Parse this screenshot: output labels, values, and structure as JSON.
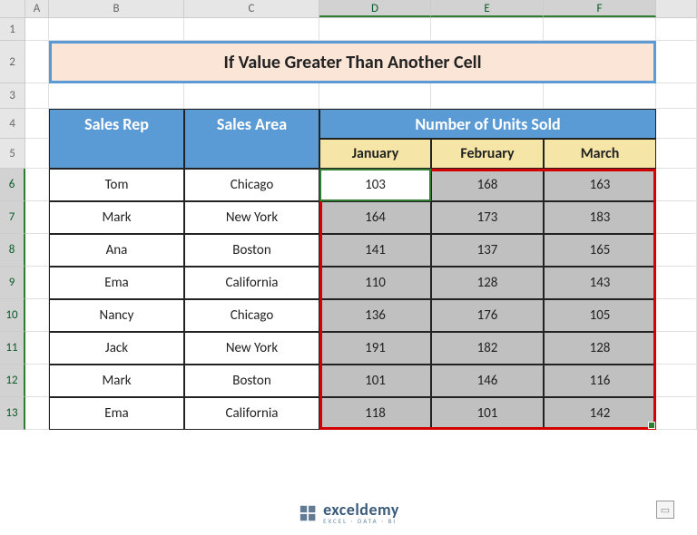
{
  "columns": [
    "A",
    "B",
    "C",
    "D",
    "E",
    "F"
  ],
  "selected_cols": [
    "D",
    "E",
    "F"
  ],
  "rows": [
    1,
    2,
    3,
    4,
    5,
    6,
    7,
    8,
    9,
    10,
    11,
    12,
    13
  ],
  "selected_rows": [
    6,
    7,
    8,
    9,
    10,
    11,
    12,
    13
  ],
  "title": "If Value Greater Than Another Cell",
  "headers": {
    "rep": "Sales Rep",
    "area": "Sales Area",
    "units": "Number of Units Sold",
    "months": [
      "January",
      "February",
      "March"
    ]
  },
  "data": [
    {
      "rep": "Tom",
      "area": "Chicago",
      "vals": [
        103,
        168,
        163
      ],
      "hl": [
        false,
        true,
        true
      ]
    },
    {
      "rep": "Mark",
      "area": "New York",
      "vals": [
        164,
        173,
        183
      ],
      "hl": [
        true,
        true,
        true
      ]
    },
    {
      "rep": "Ana",
      "area": "Boston",
      "vals": [
        141,
        137,
        165
      ],
      "hl": [
        true,
        true,
        true
      ]
    },
    {
      "rep": "Ema",
      "area": "California",
      "vals": [
        110,
        128,
        143
      ],
      "hl": [
        true,
        true,
        true
      ]
    },
    {
      "rep": "Nancy",
      "area": "Chicago",
      "vals": [
        136,
        176,
        105
      ],
      "hl": [
        true,
        true,
        true
      ]
    },
    {
      "rep": "Jack",
      "area": "New York",
      "vals": [
        191,
        182,
        128
      ],
      "hl": [
        true,
        true,
        true
      ]
    },
    {
      "rep": "Mark",
      "area": "Boston",
      "vals": [
        101,
        146,
        116
      ],
      "hl": [
        true,
        true,
        true
      ]
    },
    {
      "rep": "Ema",
      "area": "California",
      "vals": [
        118,
        101,
        142
      ],
      "hl": [
        true,
        true,
        true
      ]
    }
  ],
  "logo": {
    "main": "exceldemy",
    "sub": "EXCEL · DATA · BI"
  }
}
